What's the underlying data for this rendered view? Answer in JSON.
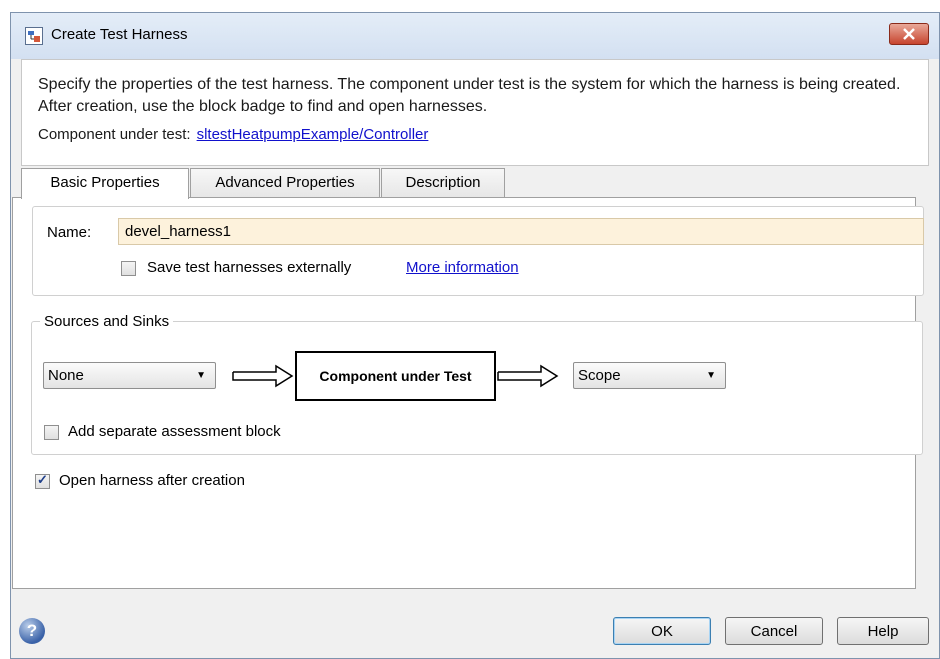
{
  "window": {
    "title": "Create Test Harness"
  },
  "header": {
    "description": "Specify the properties of the test harness. The component under test is the system for which the harness is being created. After creation, use the block badge to find and open harnesses.",
    "component_label": "Component under test:",
    "component_link": "sltestHeatpumpExample/Controller"
  },
  "tabs": [
    {
      "label": "Basic Properties",
      "active": true
    },
    {
      "label": "Advanced Properties",
      "active": false
    },
    {
      "label": "Description",
      "active": false
    }
  ],
  "basic": {
    "name_label": "Name:",
    "name_value": "devel_harness1",
    "save_externally_label": "Save test harnesses externally",
    "save_externally_checked": false,
    "more_info_link": "More information"
  },
  "sources_sinks": {
    "legend": "Sources and Sinks",
    "source_selected": "None",
    "component_box": "Component under Test",
    "sink_selected": "Scope",
    "assessment_label": "Add separate assessment block",
    "assessment_checked": false
  },
  "open_after": {
    "label": "Open harness after creation",
    "checked": true
  },
  "buttons": {
    "ok": "OK",
    "cancel": "Cancel",
    "help": "Help"
  },
  "icons": {
    "app": "simulink-harness-icon",
    "close": "close-icon",
    "help": "help-icon"
  },
  "colors": {
    "name_field_bg": "#fdf2dc",
    "link": "#1111cc",
    "close_button": "#c7452e"
  }
}
